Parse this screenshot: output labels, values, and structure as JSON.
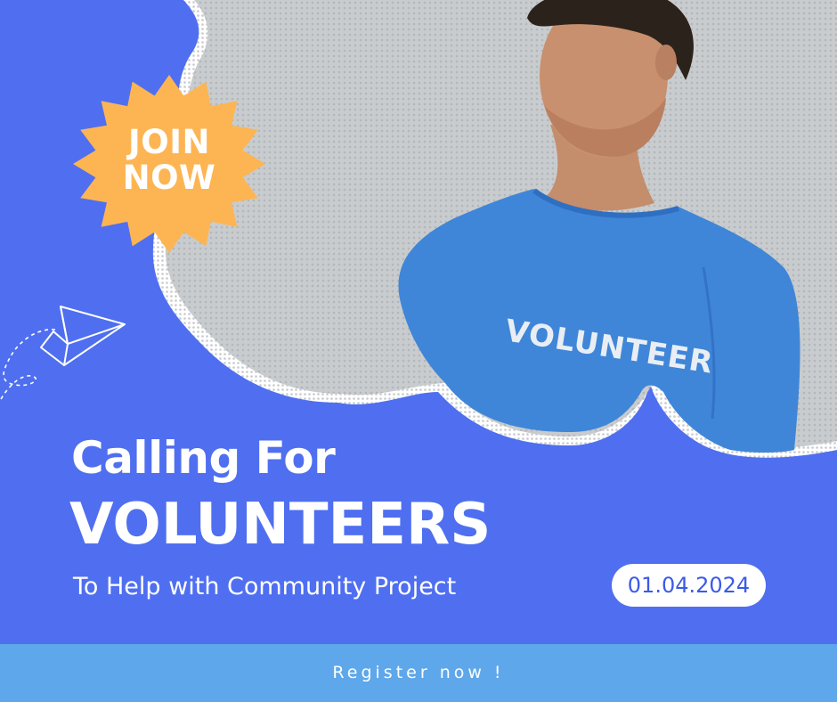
{
  "badge": {
    "line1": "JOIN",
    "line2": "NOW",
    "color": "#fdb553"
  },
  "shirt_print": "VOLUNTEER",
  "headline": {
    "line1": "Calling For",
    "line2": "VOLUNTEERS",
    "subtitle": "To Help with Community Project"
  },
  "date": "01.04.2024",
  "cta": {
    "label": "Register now !"
  },
  "colors": {
    "background": "#4f6ff0",
    "photo_backdrop": "#c9ccce",
    "shirt": "#3f86d8",
    "cta_bar": "#5ea7ea",
    "date_text": "#3c5ae8"
  },
  "icons": [
    "paper-plane-icon"
  ]
}
